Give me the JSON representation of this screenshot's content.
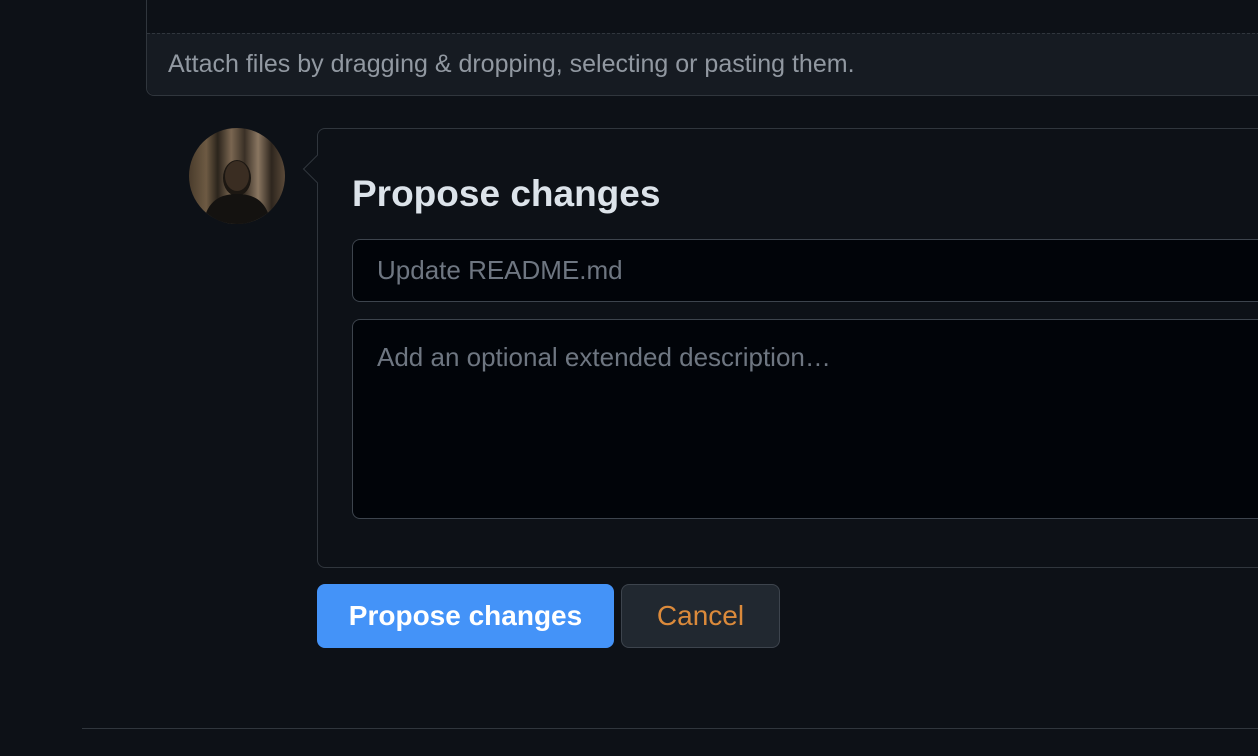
{
  "attach": {
    "text": "Attach files by dragging & dropping, selecting or pasting them."
  },
  "form": {
    "title": "Propose changes",
    "summary_placeholder": "Update README.md",
    "description_placeholder": "Add an optional extended description…"
  },
  "buttons": {
    "propose_label": "Propose changes",
    "cancel_label": "Cancel"
  },
  "colors": {
    "primary": "#4493f8",
    "cancel_text": "#db8a3b",
    "background": "#0d1117"
  },
  "icons": {
    "avatar": "user-avatar"
  }
}
